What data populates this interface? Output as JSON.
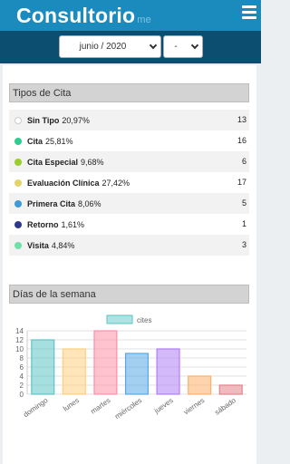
{
  "header": {
    "brand": "Consultorio",
    "brand_suffix": "me"
  },
  "filters": {
    "period": "junio / 2020",
    "secondary": "-"
  },
  "sections": {
    "types_title": "Tipos de Cita",
    "days_title": "Días de la semana"
  },
  "types": [
    {
      "label": "Sin Tipo",
      "pct": "20,97%",
      "count": "13",
      "color": "#ffffff"
    },
    {
      "label": "Cita",
      "pct": "25,81%",
      "count": "16",
      "color": "#2ecc8e"
    },
    {
      "label": "Cita Especial",
      "pct": "9,68%",
      "count": "6",
      "color": "#9acd32"
    },
    {
      "label": "Evaluación Clínica",
      "pct": "27,42%",
      "count": "17",
      "color": "#e2d36b"
    },
    {
      "label": "Primera Cita",
      "pct": "8,06%",
      "count": "5",
      "color": "#3c9bd6"
    },
    {
      "label": "Retorno",
      "pct": "1,61%",
      "count": "1",
      "color": "#2e3a8c"
    },
    {
      "label": "Visita",
      "pct": "4,84%",
      "count": "3",
      "color": "#6fe0a6"
    }
  ],
  "chart_data": {
    "type": "bar",
    "categories": [
      "domingo",
      "lunes",
      "martes",
      "miércoles",
      "jueves",
      "viernes",
      "sábado"
    ],
    "series": [
      {
        "name": "cites",
        "values": [
          12,
          10,
          14,
          9,
          10,
          4,
          2
        ]
      }
    ],
    "ylim": [
      0,
      14
    ],
    "yticks": [
      0,
      2,
      4,
      6,
      8,
      10,
      12,
      14
    ],
    "grid": true,
    "legend": "top",
    "colors": [
      "#5cc5c5",
      "#ffcf7f",
      "#ff8fa8",
      "#57a8e6",
      "#b07ff6",
      "#ffb06a",
      "#e2848a"
    ]
  }
}
